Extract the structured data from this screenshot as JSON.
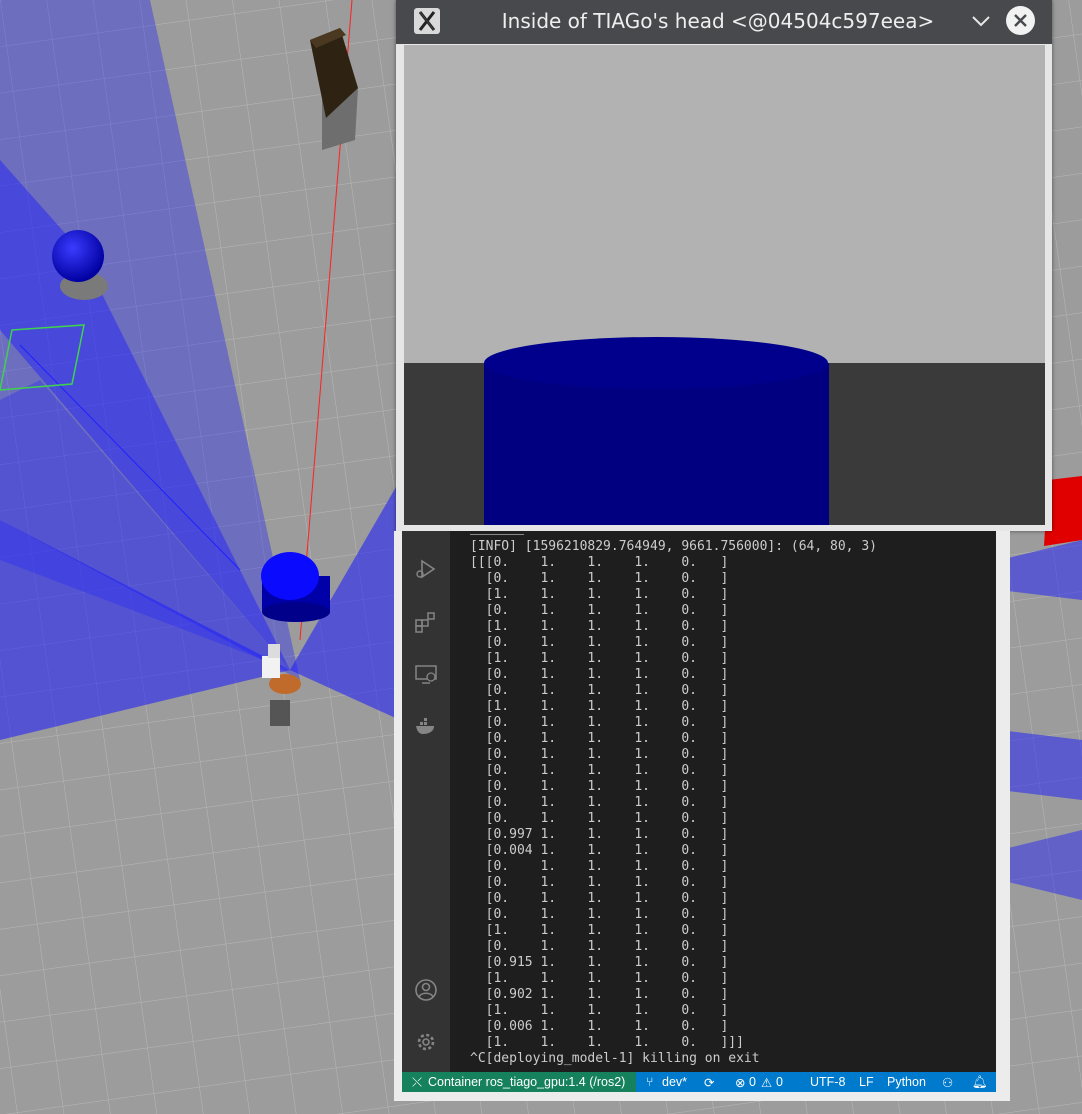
{
  "colors": {
    "floor": "#9c9c9c",
    "laser": "#1a1aff",
    "object_blue": "#0000cc",
    "titlebar": "#47494c",
    "terminal_bg": "#1e1e1e",
    "activity_bg": "#333333",
    "status_bg": "#007acc",
    "remote_bg": "#16825d"
  },
  "camera_window": {
    "title": "Inside of TIAGo's head <@04504c597eea>",
    "app_icon": "x11-icon",
    "minimize_icon": "chevron-down-icon",
    "close_icon": "close-icon"
  },
  "activity_bar": {
    "top_icons": [
      "run-debug-icon",
      "extensions-icon",
      "remote-explorer-icon",
      "docker-icon"
    ],
    "bottom_icons": [
      "account-icon",
      "settings-gear-icon"
    ]
  },
  "terminal": {
    "lines": [
      "[INFO] [1596210829.764949, 9661.756000]: (64, 80, 3)",
      "[[[0.    1.    1.    1.    0.   ]",
      "  [0.    1.    1.    1.    0.   ]",
      "  [1.    1.    1.    1.    0.   ]",
      "  [0.    1.    1.    1.    0.   ]",
      "  [1.    1.    1.    1.    0.   ]",
      "  [0.    1.    1.    1.    0.   ]",
      "  [1.    1.    1.    1.    0.   ]",
      "  [0.    1.    1.    1.    0.   ]",
      "  [0.    1.    1.    1.    0.   ]",
      "  [1.    1.    1.    1.    0.   ]",
      "  [0.    1.    1.    1.    0.   ]",
      "  [0.    1.    1.    1.    0.   ]",
      "  [0.    1.    1.    1.    0.   ]",
      "  [0.    1.    1.    1.    0.   ]",
      "  [0.    1.    1.    1.    0.   ]",
      "  [0.    1.    1.    1.    0.   ]",
      "  [0.    1.    1.    1.    0.   ]",
      "  [0.997 1.    1.    1.    0.   ]",
      "  [0.004 1.    1.    1.    0.   ]",
      "  [0.    1.    1.    1.    0.   ]",
      "  [0.    1.    1.    1.    0.   ]",
      "  [0.    1.    1.    1.    0.   ]",
      "  [0.    1.    1.    1.    0.   ]",
      "  [1.    1.    1.    1.    0.   ]",
      "  [0.    1.    1.    1.    0.   ]",
      "  [0.915 1.    1.    1.    0.   ]",
      "  [1.    1.    1.    1.    0.   ]",
      "  [0.902 1.    1.    1.    0.   ]",
      "  [1.    1.    1.    1.    0.   ]",
      "  [0.006 1.    1.    1.    0.   ]",
      "  [1.    1.    1.    1.    0.   ]]]",
      "^C[deploying_model-1] killing on exit"
    ]
  },
  "statusbar": {
    "remote": "Container ros_tiago_gpu:1.4 (/ros2)",
    "branch": "dev*",
    "errors": "0",
    "warnings": "0",
    "encoding": "UTF-8",
    "eol": "LF",
    "language": "Python"
  }
}
